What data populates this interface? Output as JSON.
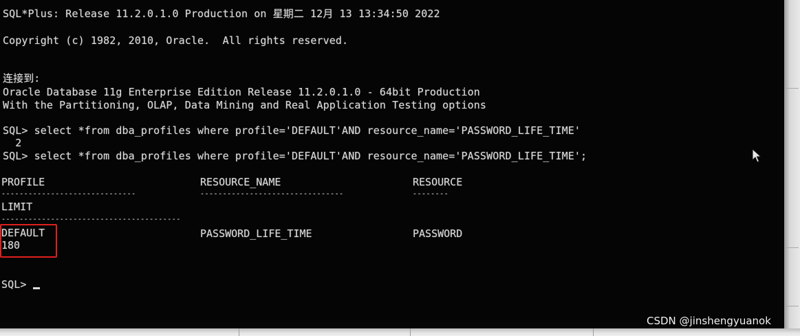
{
  "console": {
    "lines": {
      "banner": "SQL*Plus: Release 11.2.0.1.0 Production on 星期二 12月 13 13:34:50 2022",
      "copyright": "Copyright (c) 1982, 2010, Oracle.  All rights reserved.",
      "connected": "连接到:",
      "db_version": "Oracle Database 11g Enterprise Edition Release 11.2.0.1.0 - 64bit Production",
      "options": "With the Partitioning, OLAP, Data Mining and Real Application Testing options",
      "query1": "SQL> select *from dba_profiles where profile='DEFAULT'AND resource_name='PASSWORD_LIFE_TIME'",
      "continuation": "  2",
      "query2": "SQL> select *from dba_profiles where profile='DEFAULT'AND resource_name='PASSWORD_LIFE_TIME';",
      "prompt": "SQL> "
    },
    "result": {
      "headers": {
        "profile": "PROFILE",
        "resource_name": "RESOURCE_NAME",
        "resource": "RESOURCE",
        "limit": "LIMIT"
      },
      "separators": {
        "profile": "------------------------------",
        "resource_name": "--------------------------------",
        "resource": "--------",
        "limit": "----------------------------------------"
      },
      "row": {
        "profile": "DEFAULT",
        "resource_name": "PASSWORD_LIFE_TIME",
        "resource": "PASSWORD",
        "limit": "180"
      }
    },
    "highlight_color": "#e0201d",
    "text_color": "#d9d9d9",
    "background_color": "#050505"
  },
  "watermark": {
    "text": "CSDN @jinshengyuanok"
  },
  "icons": {
    "pointer": "mouse-pointer-icon"
  }
}
